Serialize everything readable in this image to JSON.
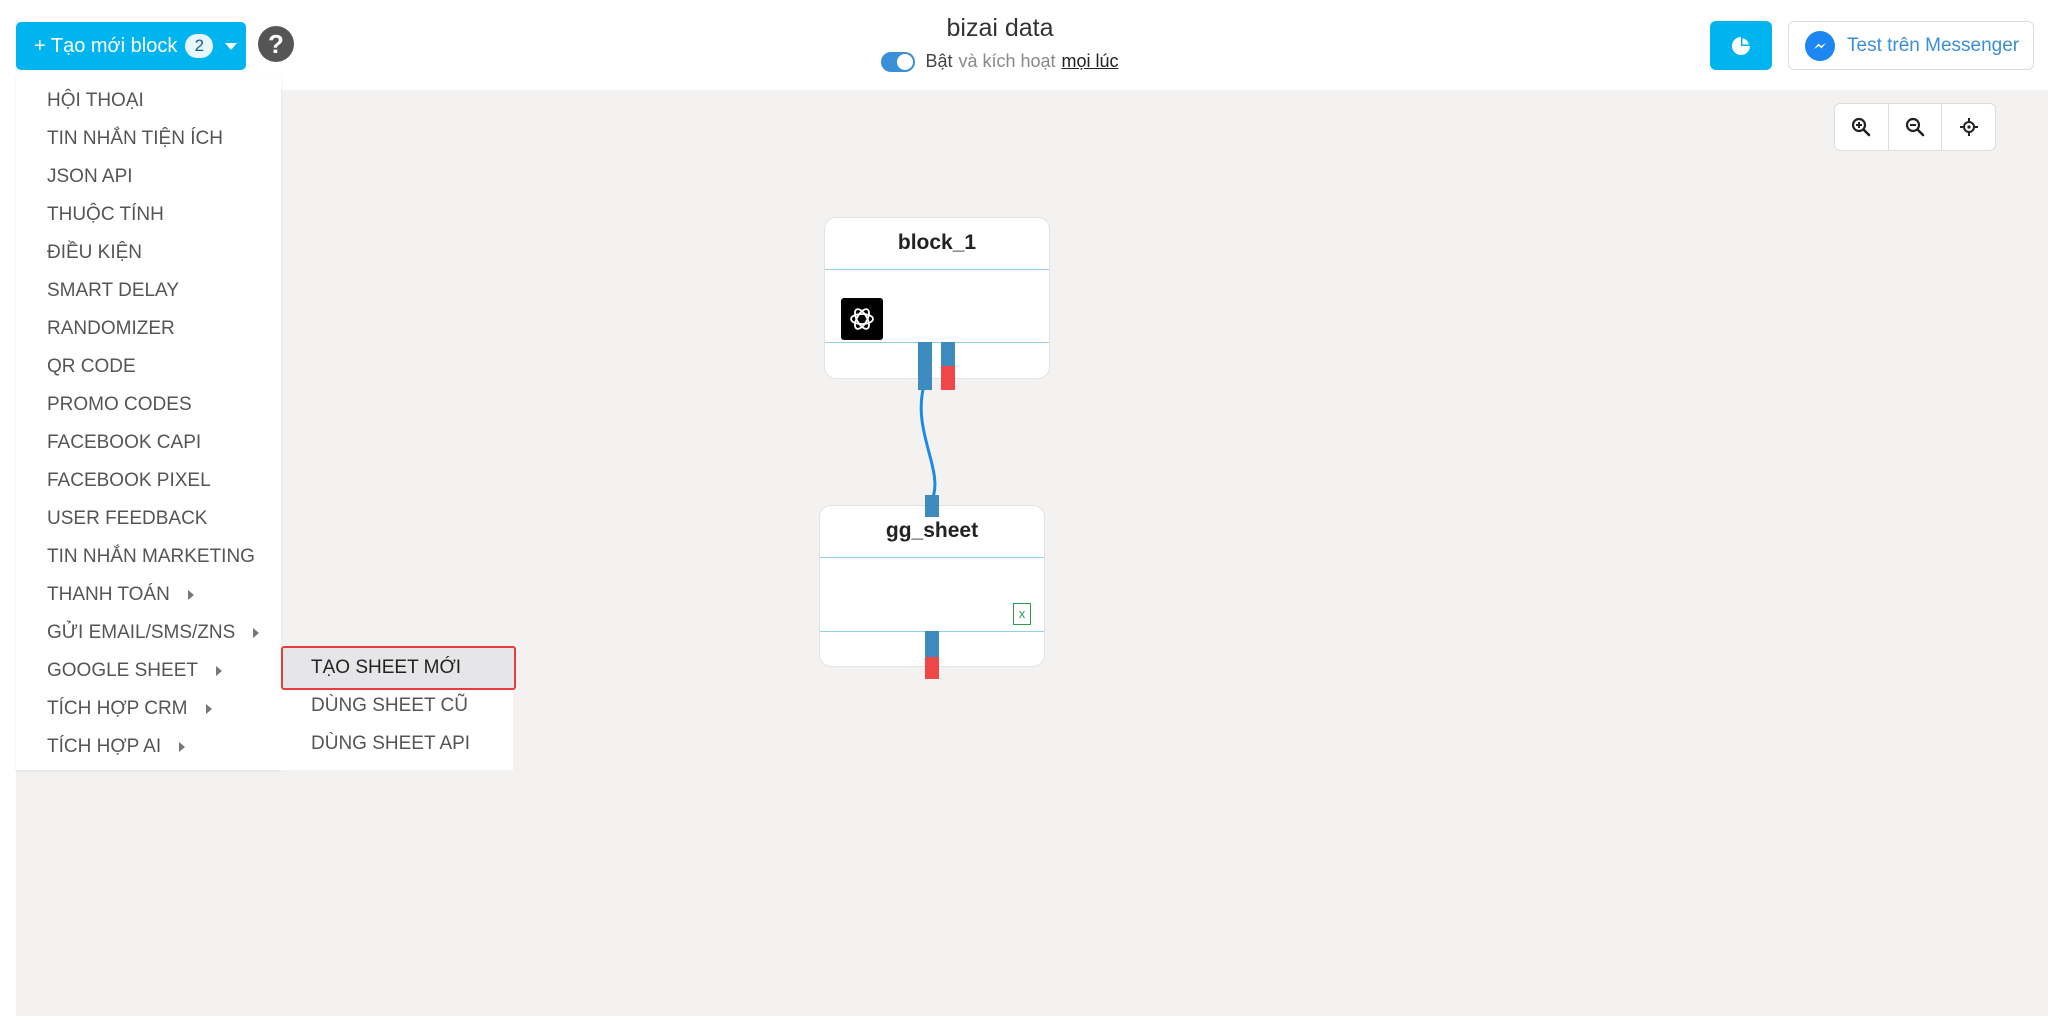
{
  "header": {
    "create_label": "+ Tạo mới block",
    "create_count": "2",
    "title": "bizai data",
    "toggle_label": "Bật",
    "toggle_mid": "và kích hoạt",
    "toggle_link": "mọi lúc",
    "messenger_label": "Test trên Messenger"
  },
  "menu": {
    "items": [
      "HỘI THOẠI",
      "TIN NHẮN TIỆN ÍCH",
      "JSON API",
      "THUỘC TÍNH",
      "ĐIỀU KIỆN",
      "SMART DELAY",
      "RANDOMIZER",
      "QR CODE",
      "PROMO CODES",
      "FACEBOOK CAPI",
      "FACEBOOK PIXEL",
      "USER FEEDBACK",
      "TIN NHẮN MARKETING",
      "THANH TOÁN",
      "GỬI EMAIL/SMS/ZNS",
      "GOOGLE SHEET",
      "TÍCH HỢP CRM",
      "TÍCH HỢP AI"
    ],
    "submenu": [
      "TẠO SHEET MỚI",
      "DÙNG SHEET CŨ",
      "DÙNG SHEET API"
    ]
  },
  "nodes": {
    "block1_title": "block_1",
    "sheet_title": "gg_sheet"
  },
  "colors": {
    "accent": "#00b4f0",
    "port_blue": "#3d8bbf",
    "port_red": "#f04848",
    "highlight_border": "#e53e3e"
  }
}
